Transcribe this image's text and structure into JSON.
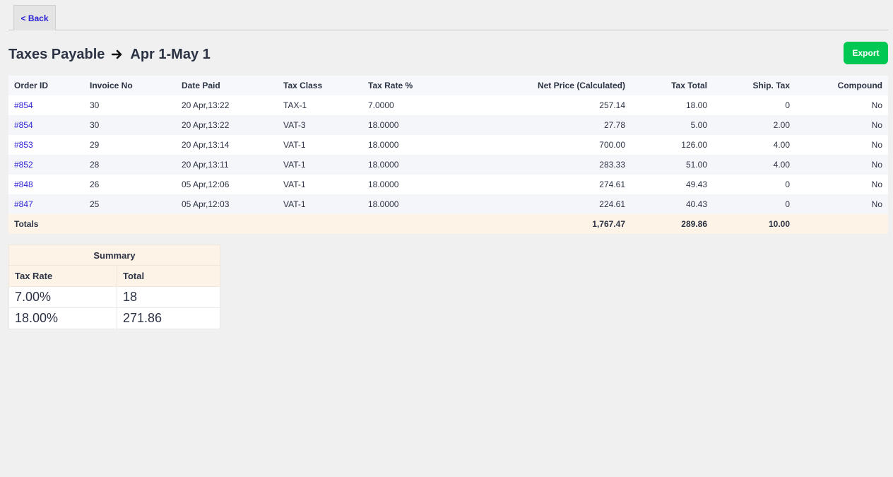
{
  "nav": {
    "back_label": "< Back"
  },
  "header": {
    "title": "Taxes Payable",
    "period": "Apr 1-May 1",
    "export_label": "Export"
  },
  "table": {
    "columns": [
      "Order ID",
      "Invoice No",
      "Date Paid",
      "Tax Class",
      "Tax Rate %",
      "Net Price (Calculated)",
      "Tax Total",
      "Ship. Tax",
      "Compound"
    ],
    "rows": [
      [
        "#854",
        "30",
        "20 Apr,13:22",
        "TAX-1",
        "7.0000",
        "257.14",
        "18.00",
        "0",
        "No"
      ],
      [
        "#854",
        "30",
        "20 Apr,13:22",
        "VAT-3",
        "18.0000",
        "27.78",
        "5.00",
        "2.00",
        "No"
      ],
      [
        "#853",
        "29",
        "20 Apr,13:14",
        "VAT-1",
        "18.0000",
        "700.00",
        "126.00",
        "4.00",
        "No"
      ],
      [
        "#852",
        "28",
        "20 Apr,13:11",
        "VAT-1",
        "18.0000",
        "283.33",
        "51.00",
        "4.00",
        "No"
      ],
      [
        "#848",
        "26",
        "05 Apr,12:06",
        "VAT-1",
        "18.0000",
        "274.61",
        "49.43",
        "0",
        "No"
      ],
      [
        "#847",
        "25",
        "05 Apr,12:03",
        "VAT-1",
        "18.0000",
        "224.61",
        "40.43",
        "0",
        "No"
      ]
    ],
    "totals": {
      "label": "Totals",
      "net_price": "1,767.47",
      "tax_total": "289.86",
      "ship_tax": "10.00"
    }
  },
  "summary": {
    "caption": "Summary",
    "col_rate": "Tax Rate",
    "col_total": "Total",
    "rows": [
      [
        "7.00%",
        "18"
      ],
      [
        "18.00%",
        "271.86"
      ]
    ]
  },
  "colors": {
    "accent": "#2a1fd6",
    "export": "#00c853",
    "totals_bg": "#fdf3e7"
  },
  "icons": {
    "title_arrow": "arrow-right-icon"
  }
}
